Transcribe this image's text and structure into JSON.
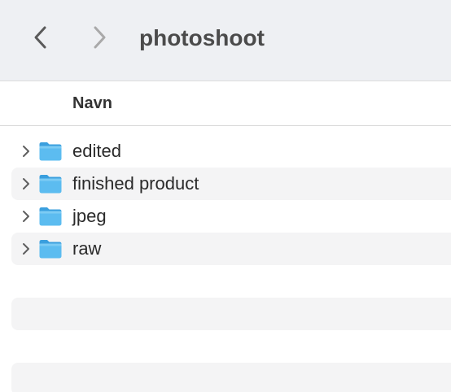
{
  "toolbar": {
    "title": "photoshoot",
    "back_icon": "chevron-left-icon",
    "forward_icon": "chevron-right-icon"
  },
  "columns": {
    "name_header": "Navn"
  },
  "colors": {
    "folder_blue": "#4fb3ec",
    "toolbar_bg": "#eef0f3",
    "stripe_bg": "#f4f4f5"
  },
  "items": [
    {
      "label": "edited",
      "icon": "folder-icon",
      "expandable": true
    },
    {
      "label": "finished product",
      "icon": "folder-icon",
      "expandable": true
    },
    {
      "label": "jpeg",
      "icon": "folder-icon",
      "expandable": true
    },
    {
      "label": "raw",
      "icon": "folder-icon",
      "expandable": true
    }
  ]
}
